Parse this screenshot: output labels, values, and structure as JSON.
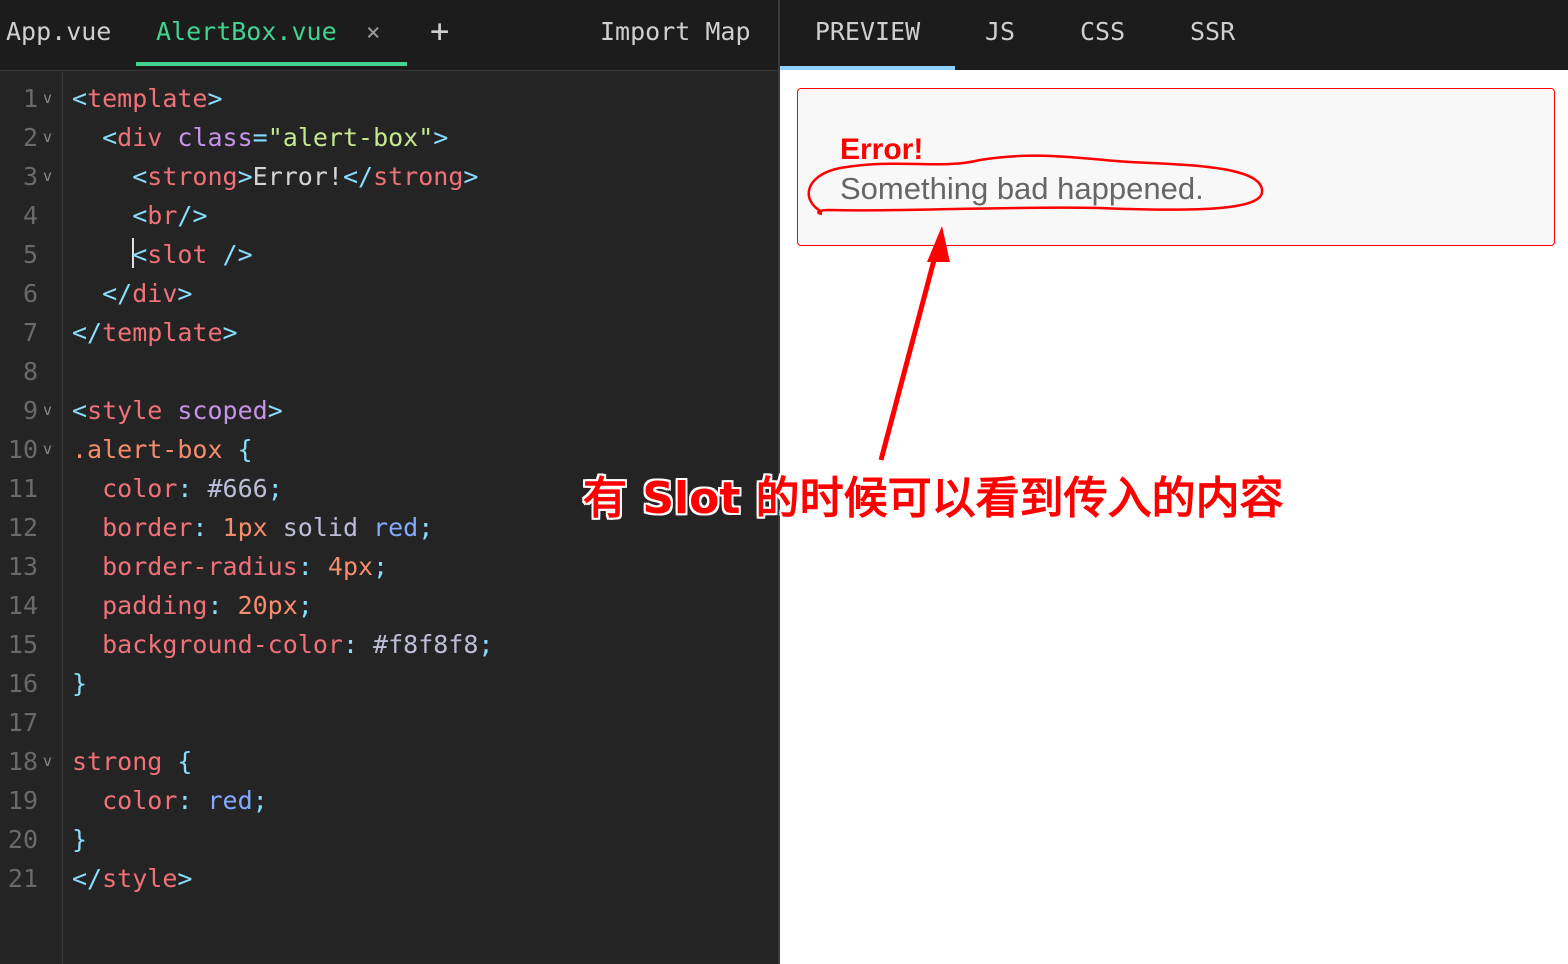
{
  "editor": {
    "tabs": {
      "app": "App.vue",
      "active": "AlertBox.vue",
      "close_icon": "×",
      "add_icon": "+",
      "import_map": "Import Map"
    },
    "line_numbers": [
      "1",
      "2",
      "3",
      "4",
      "5",
      "6",
      "7",
      "8",
      "9",
      "10",
      "11",
      "12",
      "13",
      "14",
      "15",
      "16",
      "17",
      "18",
      "19",
      "20",
      "21"
    ],
    "fold_markers": {
      "1": "v",
      "2": "v",
      "3": "v",
      "9": "v",
      "10": "v",
      "18": "v"
    },
    "lines": [
      [
        {
          "c": "p",
          "t": "<"
        },
        {
          "c": "t",
          "t": "template"
        },
        {
          "c": "p",
          "t": ">"
        }
      ],
      [
        {
          "c": "tx",
          "t": "  "
        },
        {
          "c": "p",
          "t": "<"
        },
        {
          "c": "t",
          "t": "div "
        },
        {
          "c": "a",
          "t": "class"
        },
        {
          "c": "p",
          "t": "="
        },
        {
          "c": "s",
          "t": "\"alert-box\""
        },
        {
          "c": "p",
          "t": ">"
        }
      ],
      [
        {
          "c": "tx",
          "t": "    "
        },
        {
          "c": "p",
          "t": "<"
        },
        {
          "c": "t",
          "t": "strong"
        },
        {
          "c": "p",
          "t": ">"
        },
        {
          "c": "tx",
          "t": "Error!"
        },
        {
          "c": "p",
          "t": "</"
        },
        {
          "c": "t",
          "t": "strong"
        },
        {
          "c": "p",
          "t": ">"
        }
      ],
      [
        {
          "c": "tx",
          "t": "    "
        },
        {
          "c": "p",
          "t": "<"
        },
        {
          "c": "t",
          "t": "br"
        },
        {
          "c": "p",
          "t": "/>"
        }
      ],
      [
        {
          "c": "tx",
          "t": "    "
        },
        {
          "c": "cursor",
          "t": ""
        },
        {
          "c": "p",
          "t": "<"
        },
        {
          "c": "t",
          "t": "slot "
        },
        {
          "c": "p",
          "t": "/>"
        }
      ],
      [
        {
          "c": "tx",
          "t": "  "
        },
        {
          "c": "p",
          "t": "</"
        },
        {
          "c": "t",
          "t": "div"
        },
        {
          "c": "p",
          "t": ">"
        }
      ],
      [
        {
          "c": "p",
          "t": "</"
        },
        {
          "c": "t",
          "t": "template"
        },
        {
          "c": "p",
          "t": ">"
        }
      ],
      [],
      [
        {
          "c": "p",
          "t": "<"
        },
        {
          "c": "t",
          "t": "style "
        },
        {
          "c": "a",
          "t": "scoped"
        },
        {
          "c": "p",
          "t": ">"
        }
      ],
      [
        {
          "c": "sel",
          "t": ".alert-box "
        },
        {
          "c": "p",
          "t": "{"
        }
      ],
      [
        {
          "c": "tx",
          "t": "  "
        },
        {
          "c": "prop",
          "t": "color"
        },
        {
          "c": "p",
          "t": ": "
        },
        {
          "c": "hex",
          "t": "#666"
        },
        {
          "c": "p",
          "t": ";"
        }
      ],
      [
        {
          "c": "tx",
          "t": "  "
        },
        {
          "c": "prop",
          "t": "border"
        },
        {
          "c": "p",
          "t": ": "
        },
        {
          "c": "num",
          "t": "1px "
        },
        {
          "c": "hex",
          "t": "solid "
        },
        {
          "c": "kw",
          "t": "red"
        },
        {
          "c": "p",
          "t": ";"
        }
      ],
      [
        {
          "c": "tx",
          "t": "  "
        },
        {
          "c": "prop",
          "t": "border-radius"
        },
        {
          "c": "p",
          "t": ": "
        },
        {
          "c": "num",
          "t": "4px"
        },
        {
          "c": "p",
          "t": ";"
        }
      ],
      [
        {
          "c": "tx",
          "t": "  "
        },
        {
          "c": "prop",
          "t": "padding"
        },
        {
          "c": "p",
          "t": ": "
        },
        {
          "c": "num",
          "t": "20px"
        },
        {
          "c": "p",
          "t": ";"
        }
      ],
      [
        {
          "c": "tx",
          "t": "  "
        },
        {
          "c": "prop",
          "t": "background-color"
        },
        {
          "c": "p",
          "t": ": "
        },
        {
          "c": "hex",
          "t": "#f8f8f8"
        },
        {
          "c": "p",
          "t": ";"
        }
      ],
      [
        {
          "c": "p",
          "t": "}"
        }
      ],
      [],
      [
        {
          "c": "t",
          "t": "strong "
        },
        {
          "c": "p",
          "t": "{"
        }
      ],
      [
        {
          "c": "tx",
          "t": "  "
        },
        {
          "c": "prop",
          "t": "color"
        },
        {
          "c": "p",
          "t": ": "
        },
        {
          "c": "kw",
          "t": "red"
        },
        {
          "c": "p",
          "t": ";"
        }
      ],
      [
        {
          "c": "p",
          "t": "}"
        }
      ],
      [
        {
          "c": "p",
          "t": "</"
        },
        {
          "c": "t",
          "t": "style"
        },
        {
          "c": "p",
          "t": ">"
        }
      ]
    ]
  },
  "preview": {
    "tabs": {
      "preview": "PREVIEW",
      "js": "JS",
      "css": "CSS",
      "ssr": "SSR"
    },
    "alert": {
      "title": "Error!",
      "message": "Something bad happened."
    }
  },
  "annotation": {
    "text": "有 Slot 的时候可以看到传入的内容",
    "color": "#ff0000"
  }
}
